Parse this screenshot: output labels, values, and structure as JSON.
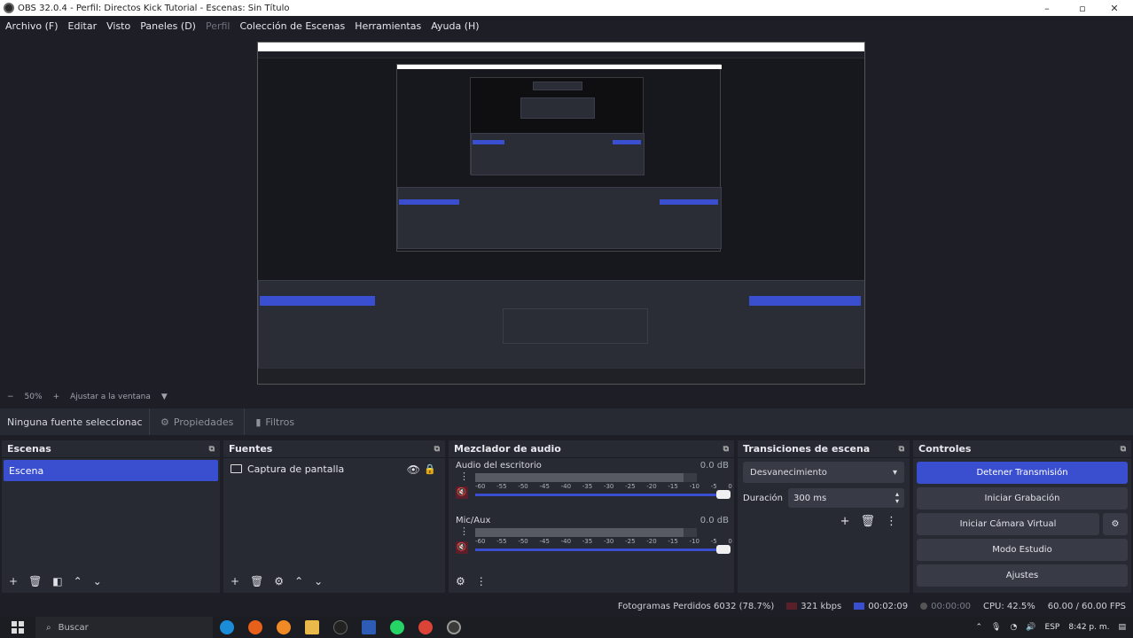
{
  "window": {
    "title": "OBS 32.0.4 - Perfil: Directos Kick Tutorial - Escenas: Sin Título",
    "minimize": "–",
    "maximize": "▫",
    "close": "✕"
  },
  "menu": [
    {
      "label": "Archivo (F)",
      "enabled": true
    },
    {
      "label": "Editar",
      "enabled": true
    },
    {
      "label": "Visto",
      "enabled": true
    },
    {
      "label": "Paneles (D)",
      "enabled": true
    },
    {
      "label": "Perfil",
      "enabled": false
    },
    {
      "label": "Colección de Escenas",
      "enabled": true
    },
    {
      "label": "Herramientas",
      "enabled": true
    },
    {
      "label": "Ayuda (H)",
      "enabled": true
    }
  ],
  "zoom": {
    "minus": "−",
    "value": "50%",
    "plus": "+",
    "fit": "Ajustar a la ventana",
    "arrow": "▼"
  },
  "source_toolbar": {
    "no_source": "Ninguna fuente seleccionac",
    "properties": "Propiedades",
    "filters": "Filtros"
  },
  "docks": {
    "scenes": {
      "title": "Escenas",
      "items": [
        "Escena"
      ]
    },
    "sources": {
      "title": "Fuentes",
      "items": [
        {
          "label": "Captura de pantalla"
        }
      ]
    },
    "mixer": {
      "title": "Mezclador de audio",
      "channels": [
        {
          "name": "Audio del escritorio",
          "db": "0.0 dB",
          "level": 0.94
        },
        {
          "name": "Mic/Aux",
          "db": "0.0 dB",
          "level": 0.94
        }
      ],
      "ticks": [
        "-60",
        "-55",
        "-50",
        "-45",
        "-40",
        "-35",
        "-30",
        "-25",
        "-20",
        "-15",
        "-10",
        "-5",
        "0"
      ]
    },
    "transitions": {
      "title": "Transiciones de escena",
      "selected": "Desvanecimiento",
      "duration_label": "Duración",
      "duration_value": "300 ms"
    },
    "controls": {
      "title": "Controles",
      "stop_stream": "Detener Transmisión",
      "start_recording": "Iniciar Grabación",
      "start_virtual_cam": "Iniciar Cámara Virtual",
      "studio_mode": "Modo Estudio",
      "settings": "Ajustes"
    }
  },
  "status": {
    "dropped_frames": "Fotogramas Perdidos 6032 (78.7%)",
    "bitrate": "321 kbps",
    "stream_time": "00:02:09",
    "rec_time": "00:00:00",
    "cpu": "CPU: 42.5%",
    "fps": "60.00 / 60.00 FPS"
  },
  "taskbar": {
    "search_placeholder": "Buscar",
    "lang": "ESP",
    "time": "8:42 p. m."
  },
  "colors": {
    "accent": "#3a4fd0",
    "panel": "#272a33",
    "background": "#1e1f26"
  }
}
